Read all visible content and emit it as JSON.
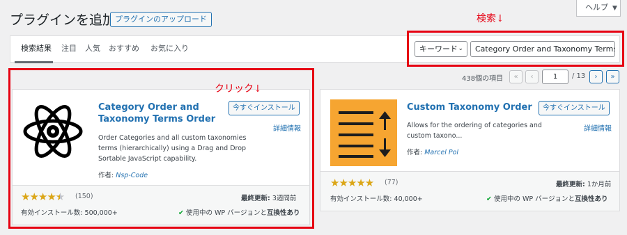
{
  "header": {
    "title": "プラグインを追加",
    "upload_button": "プラグインのアップロード",
    "help_button": "ヘルプ"
  },
  "tabs": [
    {
      "label": "検索結果"
    },
    {
      "label": "注目"
    },
    {
      "label": "人気"
    },
    {
      "label": "おすすめ"
    },
    {
      "label": "お気に入り"
    }
  ],
  "search": {
    "type_select": "キーワード",
    "query": "Category Order and Taxonomy Terms Or"
  },
  "annotations": {
    "search": "検索↓",
    "click": "クリック↓",
    "color": "#e60012"
  },
  "pagination": {
    "count": "438個の項目",
    "first": "«",
    "prev": "‹",
    "current": "1",
    "total": "/ 13",
    "next": "›",
    "last": "»"
  },
  "plugins": [
    {
      "name_line1": "Category Order and",
      "name_line2": "Taxonomy Terms Order",
      "install_button": "今すぐインストール",
      "details_link": "詳細情報",
      "desc_lines": [
        "Order Categories and all custom taxonomies",
        "terms (hierarchically) using a Drag and Drop",
        "Sortable JavaScript capability."
      ],
      "author_label": "作者:",
      "author": "Nsp-Code",
      "rating": 4.5,
      "rating_count": "(150)",
      "last_updated_label": "最終更新:",
      "last_updated": "3週間前",
      "installs": "有効インストール数: 500,000+",
      "compat_prefix": "使用中の WP バージョンと",
      "compat_bold": "互換性あり",
      "icon": "atom-icon"
    },
    {
      "name_line1": "Custom Taxonomy Order",
      "install_button": "今すぐインストール",
      "details_link": "詳細情報",
      "desc_lines": [
        "Allows for the ordering of categories and",
        "custom taxono..."
      ],
      "author_label": "作者:",
      "author": "Marcel Pol",
      "rating": 5,
      "rating_count": "(77)",
      "last_updated_label": "最終更新:",
      "last_updated": "1か月前",
      "installs": "有効インストール数: 40,000+",
      "compat_prefix": "使用中の WP バージョンと",
      "compat_bold": "互換性あり",
      "icon": "sort-list-icon",
      "icon_color": "#f6a531"
    }
  ]
}
